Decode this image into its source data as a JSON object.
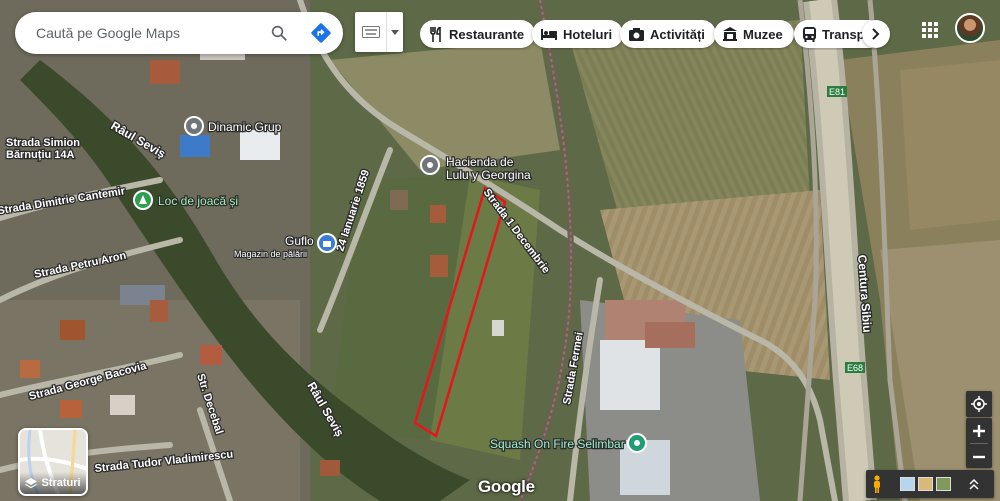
{
  "search": {
    "placeholder": "Caută pe Google Maps"
  },
  "chips": [
    {
      "label": "Restaurante",
      "icon": "fork-knife-icon"
    },
    {
      "label": "Hoteluri",
      "icon": "bed-icon"
    },
    {
      "label": "Activități",
      "icon": "camera-icon"
    },
    {
      "label": "Muzee",
      "icon": "museum-icon"
    },
    {
      "label": "Transpo",
      "icon": "bus-icon"
    }
  ],
  "layers": {
    "label": "Straturi"
  },
  "logo": {
    "text": "Google"
  },
  "map": {
    "places": [
      {
        "name": "Dinamic Grup"
      },
      {
        "name": "Hacienda de",
        "name2": "Lulu y Georgina"
      },
      {
        "name": "Loc de joacă și"
      },
      {
        "name": "Guflo",
        "sub": "Magazin de pălării"
      },
      {
        "name": "Squash On Fire Selimbar"
      }
    ],
    "streets": {
      "simion1": "Strada Simion",
      "simion2": "Bărnuțiu 14A",
      "raul1": "Râul Seviș",
      "raul2": "Râul Seviș",
      "cantemir": "Strada Dimitrie Cantemir",
      "ianuarie": "24 Ianuarie 1859",
      "decembrie": "Strada 1 Decembrie",
      "petru": "Strada Petru Aron",
      "bacovia": "Strada George Bacovia",
      "decebal": "Str. Decebal",
      "tudor": "Strada Tudor Vladimirescu",
      "fermei": "Strada Fermei",
      "centura": "Centura Sibiu",
      "e81": "E81",
      "e68": "E68"
    }
  },
  "colors": {
    "highlight": "#e8141c",
    "place_pin": "#70757a",
    "park_pin": "#2e9e4f",
    "shop_pin": "#3a7bd5",
    "sport_pin": "#1e9e72"
  }
}
